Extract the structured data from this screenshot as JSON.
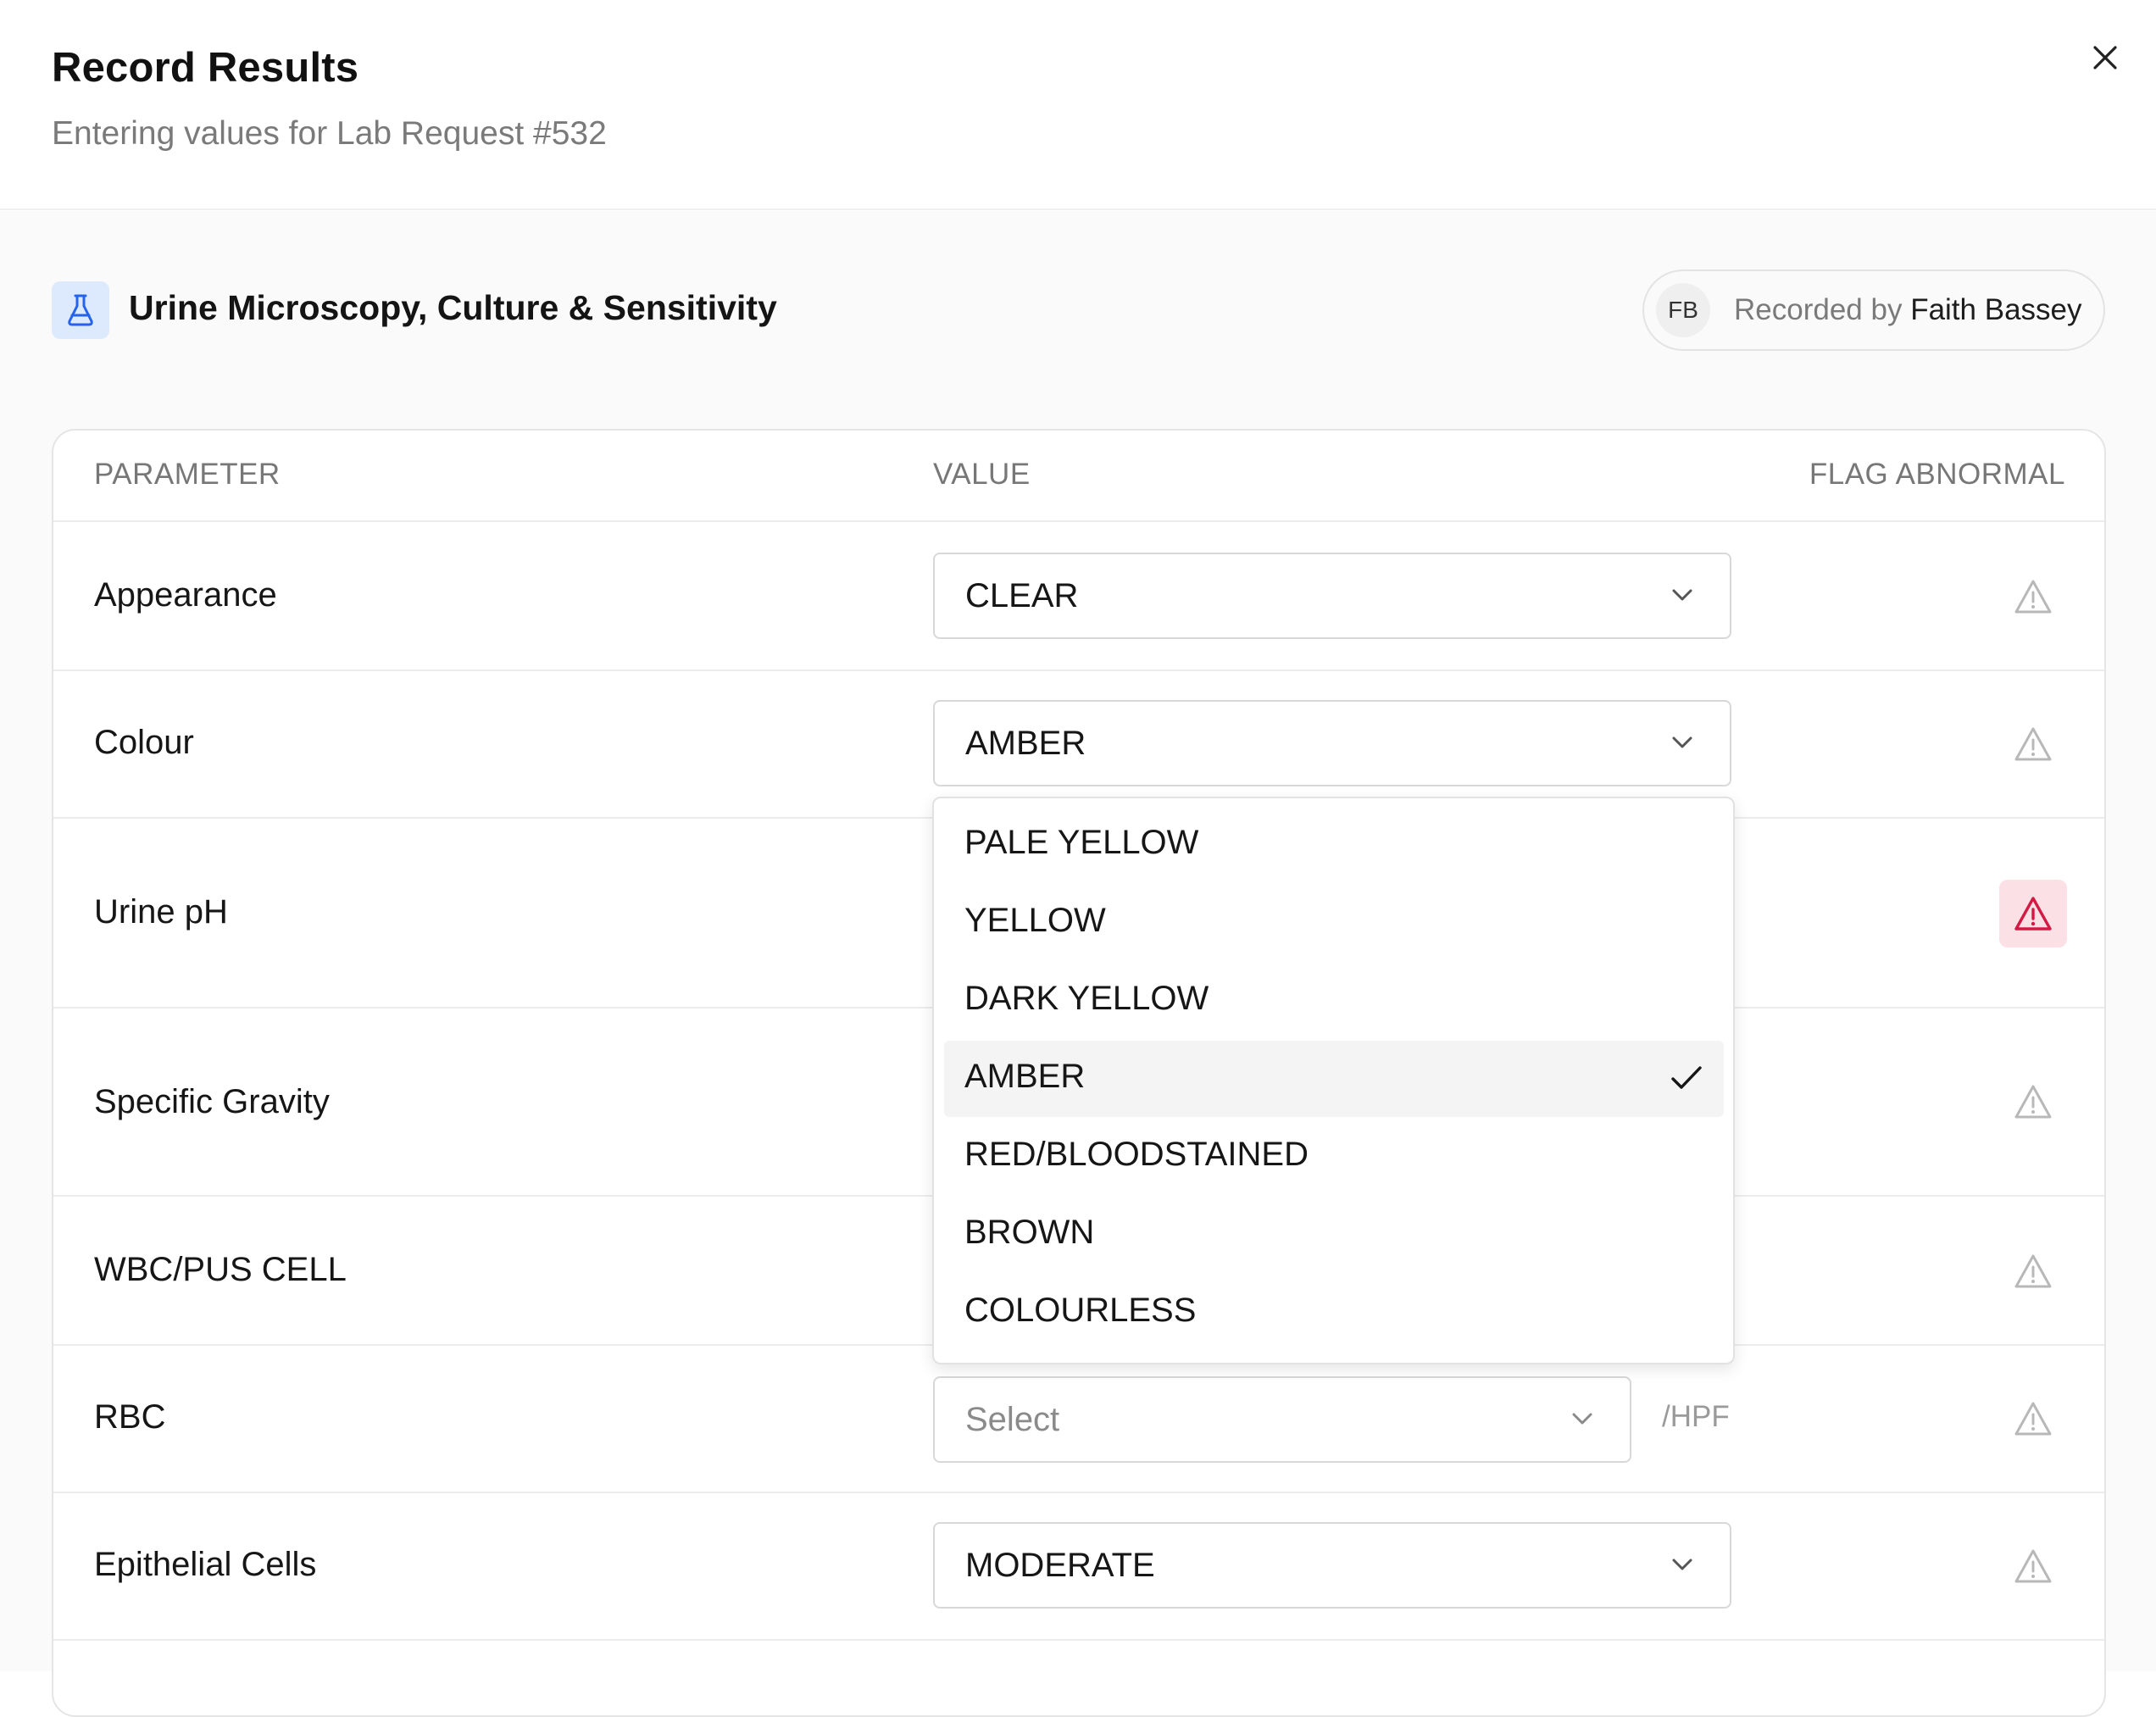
{
  "dialog": {
    "title": "Record Results",
    "subtitle": "Entering values for Lab Request #532",
    "close_icon": "close-icon"
  },
  "test": {
    "icon": "flask-icon",
    "name": "Urine Microscopy, Culture & Sensitivity",
    "recorded_by": {
      "initials": "FB",
      "prefix": "Recorded by",
      "name": "Faith Bassey"
    }
  },
  "table": {
    "headers": {
      "parameter": "PARAMETER",
      "value": "VALUE",
      "flag": "FLAG ABNORMAL"
    },
    "rows": [
      {
        "parameter": "Appearance",
        "value": "CLEAR",
        "flagged": false
      },
      {
        "parameter": "Colour",
        "value": "AMBER",
        "flagged": false
      },
      {
        "parameter": "Urine pH",
        "value": "",
        "flagged": true
      },
      {
        "parameter": "Specific Gravity",
        "value": "",
        "flagged": false
      },
      {
        "parameter": "WBC/PUS CELL",
        "value": "",
        "flagged": false
      },
      {
        "parameter": "RBC",
        "value": "Select",
        "unit": "/HPF",
        "flagged": false
      },
      {
        "parameter": "Epithelial Cells",
        "value": "MODERATE",
        "flagged": false
      }
    ]
  },
  "colour_dropdown": {
    "options": [
      "PALE YELLOW",
      "YELLOW",
      "DARK YELLOW",
      "AMBER",
      "RED/BLOODSTAINED",
      "BROWN",
      "COLOURLESS"
    ],
    "selected": "AMBER"
  },
  "colors": {
    "flag_active_bg": "#fbe1e6",
    "flag_active_icon": "#d11a44",
    "flag_inactive_icon": "#b8b8b8",
    "accent_blue": "#2563eb",
    "accent_blue_bg": "#dde9fc"
  }
}
